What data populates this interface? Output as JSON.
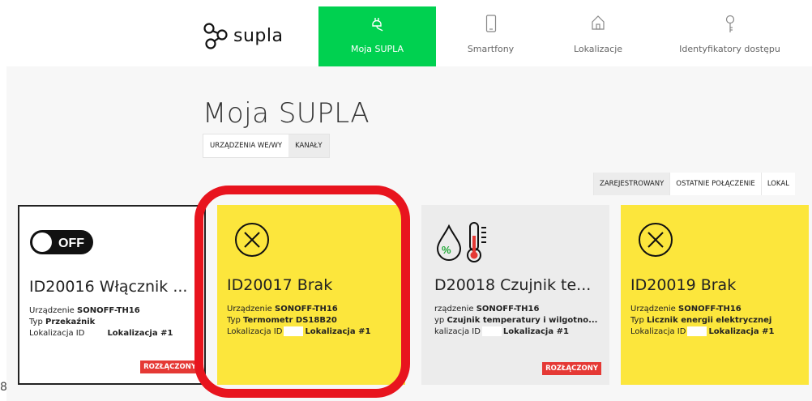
{
  "brand": {
    "logo_text": "supla"
  },
  "nav": [
    {
      "label": "Moja SUPLA",
      "icon": "plug-icon",
      "active": true
    },
    {
      "label": "Smartfony",
      "icon": "smartphone-icon",
      "active": false
    },
    {
      "label": "Lokalizacje",
      "icon": "home-icon",
      "active": false
    },
    {
      "label": "Identyfikatory dostępu",
      "icon": "key-icon",
      "active": false
    }
  ],
  "page": {
    "title": "Moja SUPLA"
  },
  "subtabs": [
    {
      "label": "URZĄDZENIA WE/WY"
    },
    {
      "label": "KANAŁY"
    }
  ],
  "sort_tabs": [
    {
      "label": "ZAREJESTROWANY"
    },
    {
      "label": "OSTATNIE POŁĄCZENIE"
    },
    {
      "label": "LOKAL"
    }
  ],
  "cards": [
    {
      "title": "ID20016 Włącznik ...",
      "device_label": "Urządzenie",
      "device": "SONOFF-TH16",
      "type_label": "Typ",
      "type": "Przekaźnik",
      "location_label": "Lokalizacja ID",
      "location": "Lokalizacja #1",
      "toggle_text": "OFF",
      "badge": "ROZŁĄCZONY"
    },
    {
      "title": "ID20017 Brak",
      "device_label": "Urządzenie",
      "device": "SONOFF-TH16",
      "type_label": "Typ",
      "type": "Termometr DS18B20",
      "location_label": "Lokalizacja ID",
      "location": "Lokalizacja #1"
    },
    {
      "title": "D20018 Czujnik te...",
      "device_label": "rządzenie",
      "device": "SONOFF-TH16",
      "type_label": "yp",
      "type": "Czujnik temperatury i wilgotno...",
      "location_label": "kalizacja ID",
      "location": "Lokalizacja #1",
      "badge": "ROZŁĄCZONY"
    },
    {
      "title": "ID20019 Brak",
      "device_label": "Urządzenie",
      "device": "SONOFF-TH16",
      "type_label": "Typ",
      "type": "Licznik energii elektrycznej",
      "location_label": "Lokalizacja ID",
      "location": "Lokalizacja #1"
    }
  ],
  "edge_label": "8",
  "colors": {
    "accent_green": "#00d150",
    "card_yellow": "#fce63c",
    "badge_red": "#e53935",
    "highlight_red": "#e8141e"
  }
}
